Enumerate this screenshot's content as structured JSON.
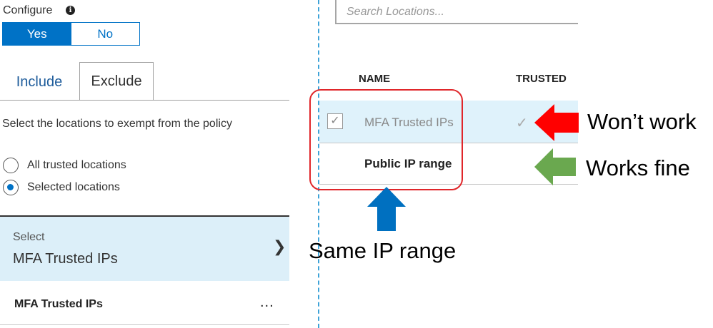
{
  "configure": {
    "label": "Configure",
    "info_icon": "info-icon",
    "toggle": {
      "yes": "Yes",
      "no": "No",
      "selected": "Yes"
    }
  },
  "tabs": {
    "include": "Include",
    "exclude": "Exclude",
    "active": "Exclude"
  },
  "description": "Select the locations to exempt from the policy",
  "radios": {
    "all": "All trusted locations",
    "selected": "Selected locations",
    "checked": "Selected locations"
  },
  "select": {
    "label": "Select",
    "value": "MFA Trusted IPs"
  },
  "left_list": {
    "row": "MFA Trusted IPs",
    "more": "..."
  },
  "search": {
    "placeholder": "Search Locations..."
  },
  "table": {
    "columns": {
      "name": "NAME",
      "trusted": "TRUSTED"
    },
    "rows": [
      {
        "name": "MFA Trusted IPs",
        "checked": true,
        "trusted": true
      },
      {
        "name": "Public IP range",
        "checked": false,
        "trusted": false
      }
    ]
  },
  "annotations": {
    "wont_work": "Won’t work",
    "works_fine": "Works fine",
    "same_range": "Same IP range"
  },
  "colors": {
    "accent": "#0072c6",
    "highlight": "#e0262a",
    "arrow_red": "#ff0000",
    "arrow_green": "#6aa84f",
    "arrow_blue": "#0070c0",
    "selected_row": "#dff2fb"
  }
}
